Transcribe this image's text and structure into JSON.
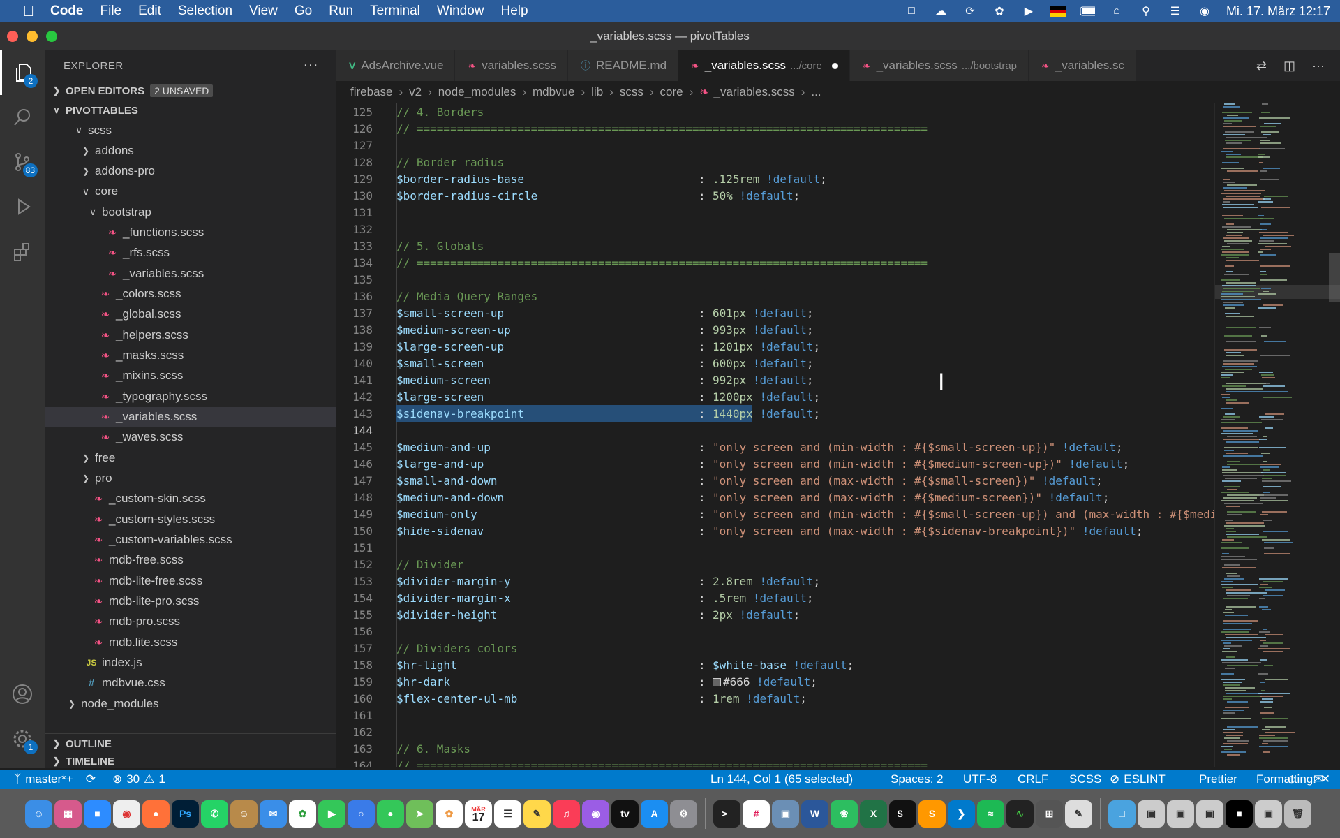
{
  "menubar": {
    "app": "Code",
    "items": [
      "File",
      "Edit",
      "Selection",
      "View",
      "Go",
      "Run",
      "Terminal",
      "Window",
      "Help"
    ],
    "clock": "Mi. 17. März  12:17"
  },
  "window": {
    "title": "_variables.scss — pivotTables"
  },
  "activity": {
    "explorer_badge": "2",
    "scm_badge": "83",
    "settings_badge": "1"
  },
  "sidebar": {
    "title": "EXPLORER",
    "open_editors": "OPEN EDITORS",
    "unsaved": "2 UNSAVED",
    "project": "PIVOTTABLES",
    "tree": [
      {
        "label": "scss",
        "icon": "folder",
        "twisty": "v",
        "indent": 2
      },
      {
        "label": "addons",
        "icon": "folder",
        "twisty": ">",
        "indent": 3
      },
      {
        "label": "addons-pro",
        "icon": "folder",
        "twisty": ">",
        "indent": 3
      },
      {
        "label": "core",
        "icon": "folder",
        "twisty": "v",
        "indent": 3
      },
      {
        "label": "bootstrap",
        "icon": "folder",
        "twisty": "v",
        "indent": 4
      },
      {
        "label": "_functions.scss",
        "icon": "sass",
        "indent": 5
      },
      {
        "label": "_rfs.scss",
        "icon": "sass",
        "indent": 5
      },
      {
        "label": "_variables.scss",
        "icon": "sass",
        "indent": 5
      },
      {
        "label": "_colors.scss",
        "icon": "sass",
        "indent": 4
      },
      {
        "label": "_global.scss",
        "icon": "sass",
        "indent": 4
      },
      {
        "label": "_helpers.scss",
        "icon": "sass",
        "indent": 4
      },
      {
        "label": "_masks.scss",
        "icon": "sass",
        "indent": 4
      },
      {
        "label": "_mixins.scss",
        "icon": "sass",
        "indent": 4
      },
      {
        "label": "_typography.scss",
        "icon": "sass",
        "indent": 4
      },
      {
        "label": "_variables.scss",
        "icon": "sass",
        "indent": 4,
        "selected": true
      },
      {
        "label": "_waves.scss",
        "icon": "sass",
        "indent": 4
      },
      {
        "label": "free",
        "icon": "folder",
        "twisty": ">",
        "indent": 3
      },
      {
        "label": "pro",
        "icon": "folder",
        "twisty": ">",
        "indent": 3
      },
      {
        "label": "_custom-skin.scss",
        "icon": "sass",
        "indent": 3
      },
      {
        "label": "_custom-styles.scss",
        "icon": "sass",
        "indent": 3
      },
      {
        "label": "_custom-variables.scss",
        "icon": "sass",
        "indent": 3
      },
      {
        "label": "mdb-free.scss",
        "icon": "sass",
        "indent": 3
      },
      {
        "label": "mdb-lite-free.scss",
        "icon": "sass",
        "indent": 3
      },
      {
        "label": "mdb-lite-pro.scss",
        "icon": "sass",
        "indent": 3
      },
      {
        "label": "mdb-pro.scss",
        "icon": "sass",
        "indent": 3
      },
      {
        "label": "mdb.lite.scss",
        "icon": "sass",
        "indent": 3
      },
      {
        "label": "index.js",
        "icon": "js",
        "indent": 2
      },
      {
        "label": "mdbvue.css",
        "icon": "css",
        "indent": 2
      },
      {
        "label": "node_modules",
        "icon": "folder",
        "twisty": ">",
        "indent": 1
      }
    ],
    "outline": "OUTLINE",
    "timeline": "TIMELINE"
  },
  "tabs": [
    {
      "label": "AdsArchive.vue",
      "icon": "vue",
      "desc": ""
    },
    {
      "label": "variables.scss",
      "icon": "sass",
      "desc": ""
    },
    {
      "label": "README.md",
      "icon": "info",
      "desc": ""
    },
    {
      "label": "_variables.scss",
      "icon": "sass",
      "desc": ".../core",
      "active": true,
      "dirty": true
    },
    {
      "label": "_variables.scss",
      "icon": "sass",
      "desc": ".../bootstrap"
    },
    {
      "label": "_variables.sc",
      "icon": "sass",
      "desc": ""
    }
  ],
  "breadcrumb": [
    "firebase",
    "v2",
    "node_modules",
    "mdbvue",
    "lib",
    "scss",
    "core",
    "_variables.scss",
    "..."
  ],
  "code": [
    {
      "n": "125",
      "t": "comment",
      "text": "// 4. Borders"
    },
    {
      "n": "126",
      "t": "comment",
      "text": "// ============================================================================"
    },
    {
      "n": "127",
      "t": "blank",
      "text": ""
    },
    {
      "n": "128",
      "t": "comment",
      "text": "// Border radius"
    },
    {
      "n": "129",
      "t": "decl",
      "name": "$border-radius-base",
      "value": ".125rem",
      "vt": "num",
      "flag": "!default",
      "end": ";"
    },
    {
      "n": "130",
      "t": "decl",
      "name": "$border-radius-circle",
      "value": "50%",
      "vt": "num",
      "flag": "!default",
      "end": ";"
    },
    {
      "n": "131",
      "t": "blank",
      "text": ""
    },
    {
      "n": "132",
      "t": "blank",
      "text": ""
    },
    {
      "n": "133",
      "t": "comment",
      "text": "// 5. Globals"
    },
    {
      "n": "134",
      "t": "comment",
      "text": "// ============================================================================"
    },
    {
      "n": "135",
      "t": "blank",
      "text": ""
    },
    {
      "n": "136",
      "t": "comment",
      "text": "// Media Query Ranges"
    },
    {
      "n": "137",
      "t": "decl",
      "name": "$small-screen-up",
      "value": "601px",
      "vt": "num",
      "flag": "!default",
      "end": ";"
    },
    {
      "n": "138",
      "t": "decl",
      "name": "$medium-screen-up",
      "value": "993px",
      "vt": "num",
      "flag": "!default",
      "end": ";"
    },
    {
      "n": "139",
      "t": "decl",
      "name": "$large-screen-up",
      "value": "1201px",
      "vt": "num",
      "flag": "!default",
      "end": ";"
    },
    {
      "n": "140",
      "t": "decl",
      "name": "$small-screen",
      "value": "600px",
      "vt": "num",
      "flag": "!default",
      "end": ";"
    },
    {
      "n": "141",
      "t": "decl",
      "name": "$medium-screen",
      "value": "992px",
      "vt": "num",
      "flag": "!default",
      "end": ";"
    },
    {
      "n": "142",
      "t": "decl",
      "name": "$large-screen",
      "value": "1200px",
      "vt": "num",
      "flag": "!default",
      "end": ";"
    },
    {
      "n": "143",
      "t": "decl",
      "name": "$sidenav-breakpoint",
      "value": "1440px",
      "vt": "num",
      "flag": "!default",
      "end": ";",
      "selected": true
    },
    {
      "n": "144",
      "t": "blank",
      "text": "",
      "current": true
    },
    {
      "n": "145",
      "t": "decl",
      "name": "$medium-and-up",
      "value": "\"only screen and (min-width : #{$small-screen-up})\"",
      "vt": "str",
      "flag": "!default",
      "end": ";"
    },
    {
      "n": "146",
      "t": "decl",
      "name": "$large-and-up",
      "value": "\"only screen and (min-width : #{$medium-screen-up})\"",
      "vt": "str",
      "flag": "!default",
      "end": ";"
    },
    {
      "n": "147",
      "t": "decl",
      "name": "$small-and-down",
      "value": "\"only screen and (max-width : #{$small-screen})\"",
      "vt": "str",
      "flag": "!default",
      "end": ";"
    },
    {
      "n": "148",
      "t": "decl",
      "name": "$medium-and-down",
      "value": "\"only screen and (max-width : #{$medium-screen})\"",
      "vt": "str",
      "flag": "!default",
      "end": ";"
    },
    {
      "n": "149",
      "t": "decl",
      "name": "$medium-only",
      "value": "\"only screen and (min-width : #{$small-screen-up}) and (max-width : #{$medi",
      "vt": "str",
      "flag": "",
      "end": ""
    },
    {
      "n": "150",
      "t": "decl",
      "name": "$hide-sidenav",
      "value": "\"only screen and (max-width : #{$sidenav-breakpoint})\"",
      "vt": "str",
      "flag": "!default",
      "end": ";"
    },
    {
      "n": "151",
      "t": "blank",
      "text": ""
    },
    {
      "n": "152",
      "t": "comment",
      "text": "// Divider"
    },
    {
      "n": "153",
      "t": "decl",
      "name": "$divider-margin-y",
      "value": "2.8rem",
      "vt": "num",
      "flag": "!default",
      "end": ";"
    },
    {
      "n": "154",
      "t": "decl",
      "name": "$divider-margin-x",
      "value": ".5rem",
      "vt": "num",
      "flag": "!default",
      "end": ";"
    },
    {
      "n": "155",
      "t": "decl",
      "name": "$divider-height",
      "value": "2px",
      "vt": "num",
      "flag": "!default",
      "end": ";"
    },
    {
      "n": "156",
      "t": "blank",
      "text": ""
    },
    {
      "n": "157",
      "t": "comment",
      "text": "// Dividers colors"
    },
    {
      "n": "158",
      "t": "decl",
      "name": "$hr-light",
      "value": "$white-base",
      "vt": "var",
      "flag": "!default",
      "end": ";"
    },
    {
      "n": "159",
      "t": "decl",
      "name": "$hr-dark",
      "value": "#666",
      "vt": "color",
      "flag": "!default",
      "end": ";"
    },
    {
      "n": "160",
      "t": "decl",
      "name": "$flex-center-ul-mb",
      "value": "1rem",
      "vt": "num",
      "flag": "!default",
      "end": ";"
    },
    {
      "n": "161",
      "t": "blank",
      "text": ""
    },
    {
      "n": "162",
      "t": "blank",
      "text": ""
    },
    {
      "n": "163",
      "t": "comment",
      "text": "// 6. Masks"
    },
    {
      "n": "164",
      "t": "comment",
      "text": "// ============================================================================"
    }
  ],
  "status": {
    "branch": "master*+",
    "errors": "30",
    "warnings": "1",
    "position": "Ln 144, Col 1 (65 selected)",
    "spaces": "Spaces: 2",
    "encoding": "UTF-8",
    "eol": "CRLF",
    "language": "SCSS",
    "eslint": "ESLINT",
    "prettier": "Prettier",
    "formatting": "Formatting:"
  },
  "dock": {
    "calendar_month": "MÄR",
    "calendar_day": "17"
  },
  "colors": {
    "accent": "#007acc",
    "menubar": "#2b5d9c",
    "selection": "#264f78"
  }
}
